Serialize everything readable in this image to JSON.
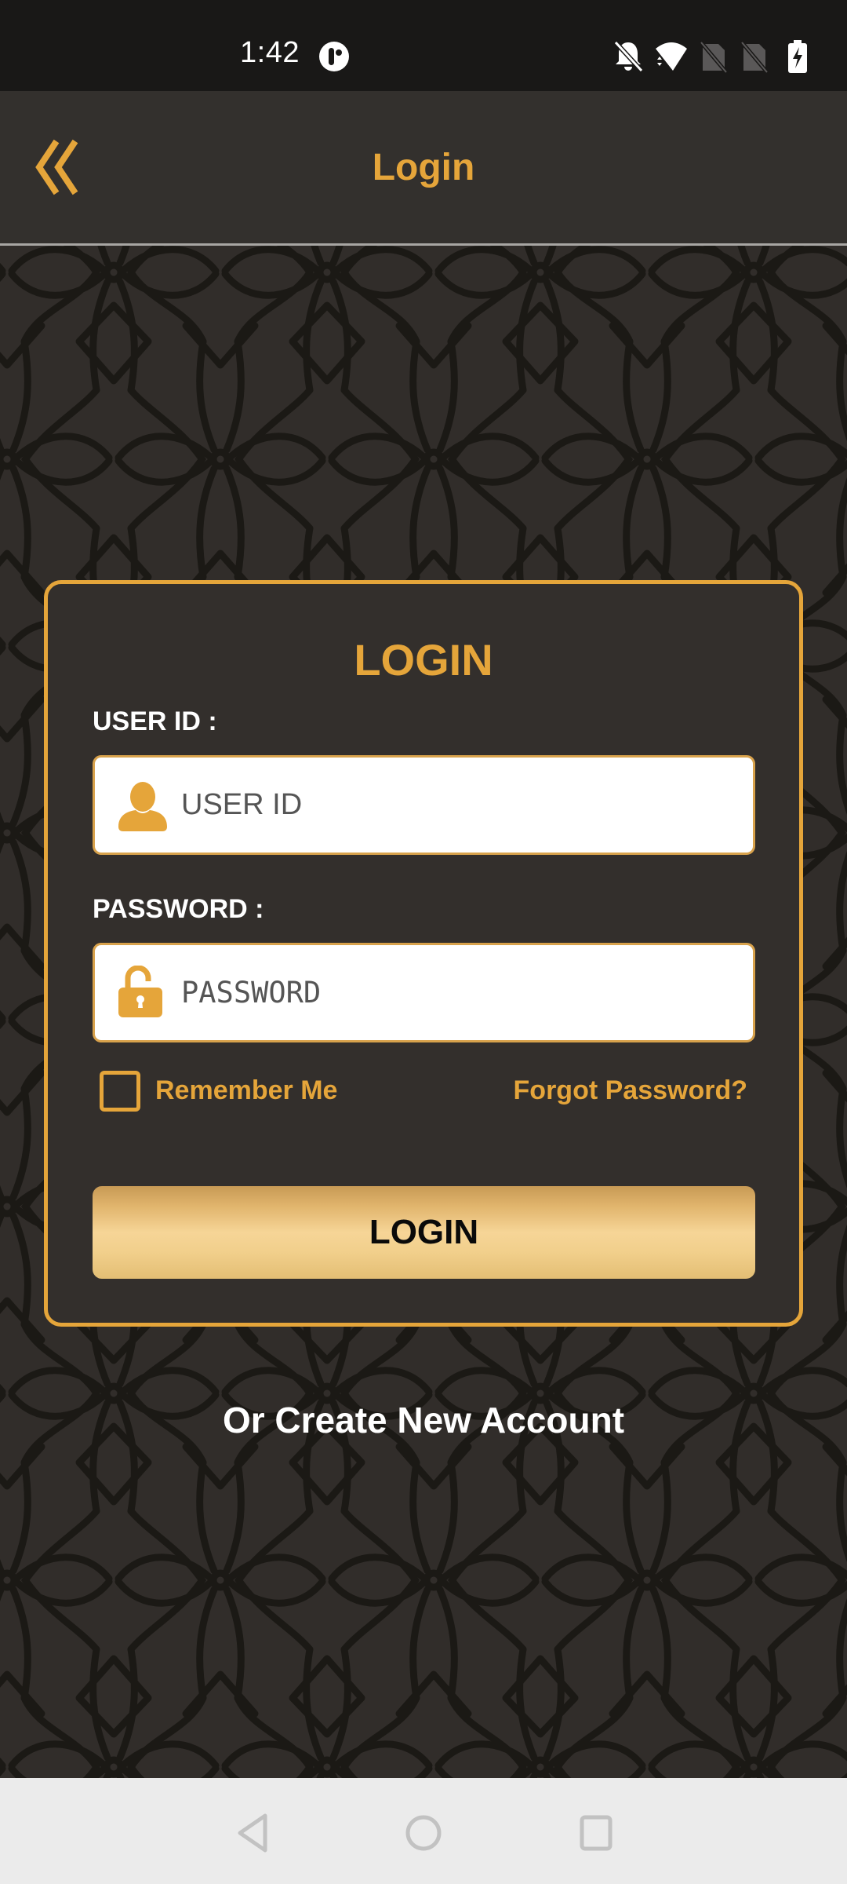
{
  "status_bar": {
    "time": "1:42",
    "icons": [
      "app-notification-icon",
      "bell-off-icon",
      "wifi-icon",
      "no-sim-icon",
      "no-sim-icon",
      "battery-charging-icon"
    ]
  },
  "header": {
    "back_icon": "double-chevron-left-icon",
    "title": "Login"
  },
  "login_card": {
    "title": "LOGIN",
    "user_id": {
      "label": "USER ID :",
      "placeholder": "USER ID",
      "value": "",
      "icon": "user-icon"
    },
    "password": {
      "label": "PASSWORD :",
      "placeholder": "PASSWORD",
      "value": "",
      "icon": "unlock-icon"
    },
    "remember_me": {
      "label": "Remember Me",
      "checked": false
    },
    "forgot_password": "Forgot Password?",
    "login_button": "LOGIN"
  },
  "create_account": "Or Create New Account",
  "nav_bar": {
    "buttons": [
      "back-nav-icon",
      "home-nav-icon",
      "recents-nav-icon"
    ]
  },
  "colors": {
    "accent": "#e5a53a",
    "background": "#312d2a",
    "status_bar": "#191817",
    "nav_bar": "#ebebeb"
  }
}
